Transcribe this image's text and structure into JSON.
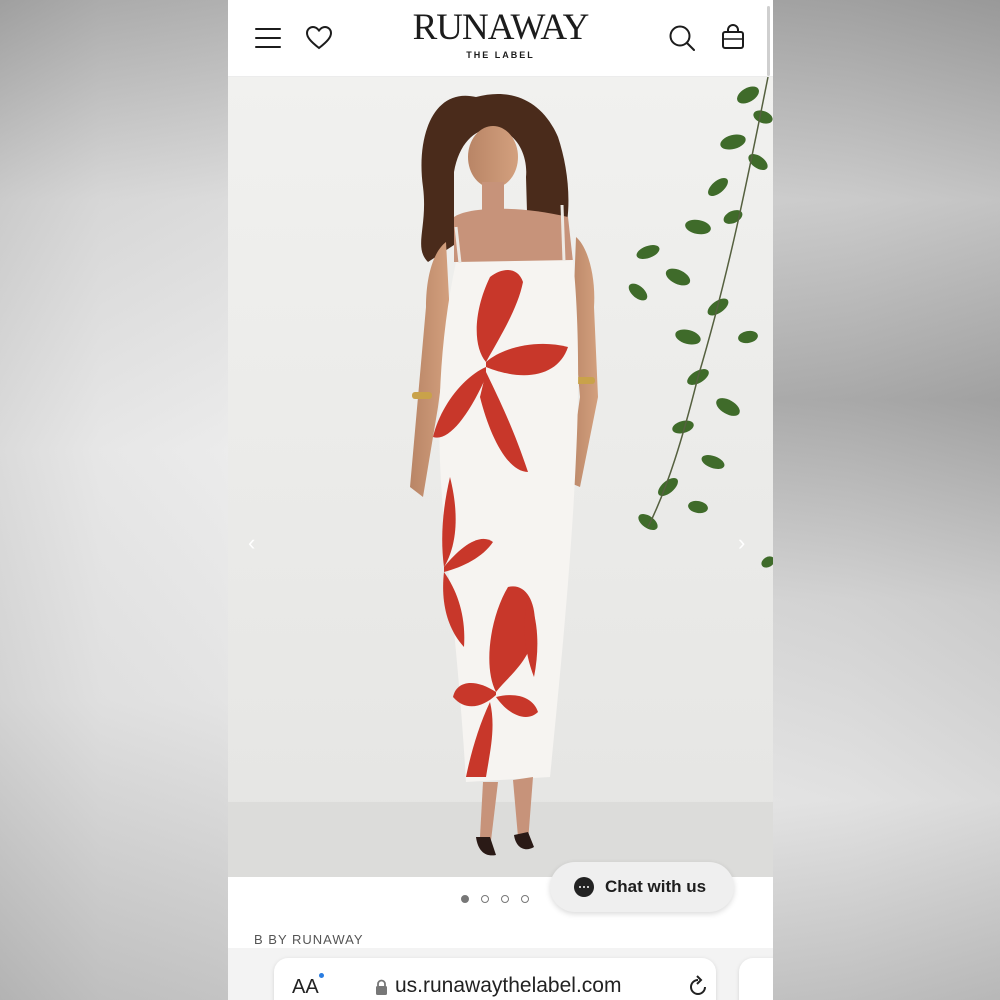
{
  "header": {
    "logo_main": "RUNAWAY",
    "logo_sub": "THE LABEL",
    "menu_icon": "menu-icon",
    "wishlist_icon": "heart-icon",
    "search_icon": "search-icon",
    "bag_icon": "shopping-bag-icon"
  },
  "gallery": {
    "prev_arrow": "‹",
    "next_arrow": "›",
    "slide_count": 4,
    "active_slide": 1
  },
  "chat": {
    "label": "Chat with us",
    "icon": "chat-bubble-icon"
  },
  "product": {
    "brand": "B BY RUNAWAY"
  },
  "browser": {
    "text_size_label": "AA",
    "url": "us.runawaythelabel.com",
    "lock_icon": "lock-icon",
    "reload_icon": "reload-icon"
  },
  "colors": {
    "accent_red": "#c8372a",
    "text_dark": "#1c1c1c",
    "link_blue": "#2a7de1"
  }
}
